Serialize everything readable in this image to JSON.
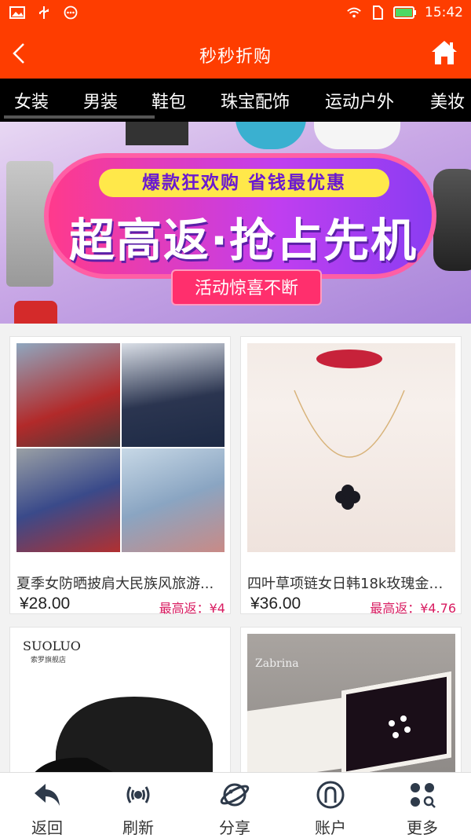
{
  "status_bar": {
    "time": "15:42",
    "left_icons": [
      "image-icon",
      "usb-icon",
      "more-dots-icon"
    ],
    "right_icons": [
      "wifi-icon",
      "sim-icon",
      "battery-icon"
    ]
  },
  "header": {
    "title": "秒秒折购",
    "back_icon": "chevron-left-icon",
    "home_icon": "home-icon",
    "bg_color": "#fe3d00"
  },
  "category_tabs": [
    "女装",
    "男装",
    "鞋包",
    "珠宝配饰",
    "运动户外",
    "美妆"
  ],
  "banner": {
    "tagline": "爆款狂欢购  省钱最优惠",
    "headline": "超高返·抢占先机",
    "badge": "活动惊喜不断"
  },
  "products": [
    {
      "name": "夏季女防晒披肩大民族风旅游...",
      "price": "¥28.00",
      "rebate": "最高返：¥4"
    },
    {
      "name": "四叶草项链女日韩18k玫瑰金韩...",
      "price": "¥36.00",
      "rebate": "最高返：¥4.76"
    },
    {
      "brand": "SUOLUO",
      "brand_sub": "索罗旗舰店"
    },
    {
      "brand": "Zabrina"
    }
  ],
  "bottom_nav": [
    {
      "label": "返回",
      "icon": "back-arrow-icon"
    },
    {
      "label": "刷新",
      "icon": "refresh-icon"
    },
    {
      "label": "分享",
      "icon": "share-icon"
    },
    {
      "label": "账户",
      "icon": "account-icon"
    },
    {
      "label": "更多",
      "icon": "more-grid-icon"
    }
  ]
}
